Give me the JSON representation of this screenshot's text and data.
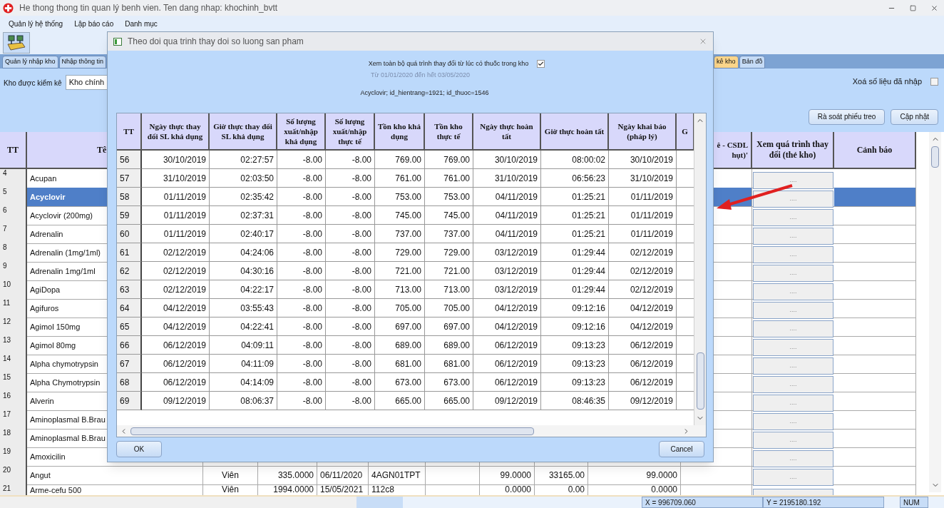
{
  "window": {
    "title": "He thong thong tin quan lý benh vien. Ten dang nhap: khochinh_bvtt"
  },
  "menu": [
    "Quản lý hệ thống",
    "Lập báo cáo",
    "Danh mục"
  ],
  "tabs": [
    {
      "label": "Quản lý nhập kho",
      "selected": false
    },
    {
      "label": "Nhập thông tin",
      "selected": false
    },
    {
      "label": "kê kho",
      "selected": true
    },
    {
      "label": "Bản đồ",
      "selected": false
    }
  ],
  "filter": {
    "label": "Kho được kiểm kê",
    "value": "Kho chính"
  },
  "clear_entered": {
    "label": "Xoá số liệu đã nhập",
    "checked": false
  },
  "buttons": [
    "Rà soát phiếu treo",
    "Cập nhật"
  ],
  "main_table": {
    "columns": {
      "tt": "TT",
      "name": "Tê",
      "diff": "ê - CSDL hụt)'",
      "history": "Xem quá trình thay đổi (thẻ kho)",
      "warning": "Cảnh báo"
    },
    "rows": [
      {
        "tt": "4",
        "name": "Acupan",
        "selected": false,
        "history": "...."
      },
      {
        "tt": "5",
        "name": "Acyclovir",
        "selected": true,
        "history": "...."
      },
      {
        "tt": "6",
        "name": "Acyclovir (200mg)",
        "selected": false,
        "history": "...."
      },
      {
        "tt": "7",
        "name": "Adrenalin",
        "selected": false,
        "history": "...."
      },
      {
        "tt": "8",
        "name": "Adrenalin (1mg/1ml)",
        "selected": false,
        "history": "...."
      },
      {
        "tt": "9",
        "name": "Adrenalin 1mg/1ml",
        "selected": false,
        "history": "...."
      },
      {
        "tt": "10",
        "name": "AgiDopa",
        "selected": false,
        "history": "...."
      },
      {
        "tt": "11",
        "name": "Agifuros",
        "selected": false,
        "history": "...."
      },
      {
        "tt": "12",
        "name": "Agimol 150mg",
        "selected": false,
        "history": "...."
      },
      {
        "tt": "13",
        "name": "Agimol 80mg",
        "selected": false,
        "history": "...."
      },
      {
        "tt": "14",
        "name": "Alpha chymotrypsin",
        "selected": false,
        "history": "...."
      },
      {
        "tt": "15",
        "name": "Alpha Chymotrypsin",
        "selected": false,
        "history": "...."
      },
      {
        "tt": "16",
        "name": "Alverin",
        "selected": false,
        "history": "...."
      },
      {
        "tt": "17",
        "name": "Aminoplasmal B.Brau",
        "selected": false,
        "history": "...."
      },
      {
        "tt": "18",
        "name": "Aminoplasmal B.Brau",
        "selected": false,
        "history": "...."
      },
      {
        "tt": "19",
        "name": "Amoxicilin",
        "selected": false,
        "history": "...."
      },
      {
        "tt": "20",
        "name": "Angut",
        "selected": false,
        "history": "....",
        "cells": [
          "Viên",
          "335.0000",
          "06/11/2020",
          "4AGN01TPT",
          null,
          "99.0000",
          "33165.00",
          "99.0000"
        ]
      },
      {
        "tt": "21",
        "name": "Arme-cefu 500",
        "selected": false,
        "cells": [
          "Viên",
          "1994.0000",
          "15/05/2021",
          "112c8",
          null,
          "0.0000",
          "0.00",
          "0.0000"
        ]
      }
    ]
  },
  "status_bar": [
    "X = 996709.060",
    "Y = 2195180.192",
    "NUM"
  ],
  "dialog": {
    "title": "Theo doi qua trinh thay doi so luong san pham",
    "show_all": {
      "label": "Xem toàn bộ quá trình thay đổi từ lúc có thuốc trong kho",
      "checked": true
    },
    "range": "Từ 01/01/2020 đến hết 03/05/2020",
    "info": "Acyclovir; id_hientrang=1921; id_thuoc=1546",
    "columns": [
      "TT",
      "Ngày thực thay đổi SL khả dụng",
      "Giờ thực thay đổi SL khả dụng",
      "Số lượng xuất/nhập khả dụng",
      "Số lượng xuất/nhập thực tế",
      "Tồn kho khả dụng",
      "Tồn kho thực tế",
      "Ngày thực hoàn tất",
      "Giờ thực hoàn tất",
      "Ngày khai báo (pháp lý)",
      "G"
    ],
    "rows": [
      [
        "56",
        "30/10/2019",
        "02:27:57",
        "-8.00",
        "-8.00",
        "769.00",
        "769.00",
        "30/10/2019",
        "08:00:02",
        "30/10/2019"
      ],
      [
        "57",
        "31/10/2019",
        "02:03:50",
        "-8.00",
        "-8.00",
        "761.00",
        "761.00",
        "31/10/2019",
        "06:56:23",
        "31/10/2019"
      ],
      [
        "58",
        "01/11/2019",
        "02:35:42",
        "-8.00",
        "-8.00",
        "753.00",
        "753.00",
        "04/11/2019",
        "01:25:21",
        "01/11/2019"
      ],
      [
        "59",
        "01/11/2019",
        "02:37:31",
        "-8.00",
        "-8.00",
        "745.00",
        "745.00",
        "04/11/2019",
        "01:25:21",
        "01/11/2019"
      ],
      [
        "60",
        "01/11/2019",
        "02:40:17",
        "-8.00",
        "-8.00",
        "737.00",
        "737.00",
        "04/11/2019",
        "01:25:21",
        "01/11/2019"
      ],
      [
        "61",
        "02/12/2019",
        "04:24:06",
        "-8.00",
        "-8.00",
        "729.00",
        "729.00",
        "03/12/2019",
        "01:29:44",
        "02/12/2019"
      ],
      [
        "62",
        "02/12/2019",
        "04:30:16",
        "-8.00",
        "-8.00",
        "721.00",
        "721.00",
        "03/12/2019",
        "01:29:44",
        "02/12/2019"
      ],
      [
        "63",
        "02/12/2019",
        "04:22:17",
        "-8.00",
        "-8.00",
        "713.00",
        "713.00",
        "03/12/2019",
        "01:29:44",
        "02/12/2019"
      ],
      [
        "64",
        "04/12/2019",
        "03:55:43",
        "-8.00",
        "-8.00",
        "705.00",
        "705.00",
        "04/12/2019",
        "09:12:16",
        "04/12/2019"
      ],
      [
        "65",
        "04/12/2019",
        "04:22:41",
        "-8.00",
        "-8.00",
        "697.00",
        "697.00",
        "04/12/2019",
        "09:12:16",
        "04/12/2019"
      ],
      [
        "66",
        "06/12/2019",
        "04:09:11",
        "-8.00",
        "-8.00",
        "689.00",
        "689.00",
        "06/12/2019",
        "09:13:23",
        "06/12/2019"
      ],
      [
        "67",
        "06/12/2019",
        "04:11:09",
        "-8.00",
        "-8.00",
        "681.00",
        "681.00",
        "06/12/2019",
        "09:13:23",
        "06/12/2019"
      ],
      [
        "68",
        "06/12/2019",
        "04:14:09",
        "-8.00",
        "-8.00",
        "673.00",
        "673.00",
        "06/12/2019",
        "09:13:23",
        "06/12/2019"
      ],
      [
        "69",
        "09/12/2019",
        "08:06:37",
        "-8.00",
        "-8.00",
        "665.00",
        "665.00",
        "09/12/2019",
        "08:46:35",
        "09/12/2019"
      ]
    ],
    "buttons": [
      "OK",
      "Cancel"
    ]
  }
}
